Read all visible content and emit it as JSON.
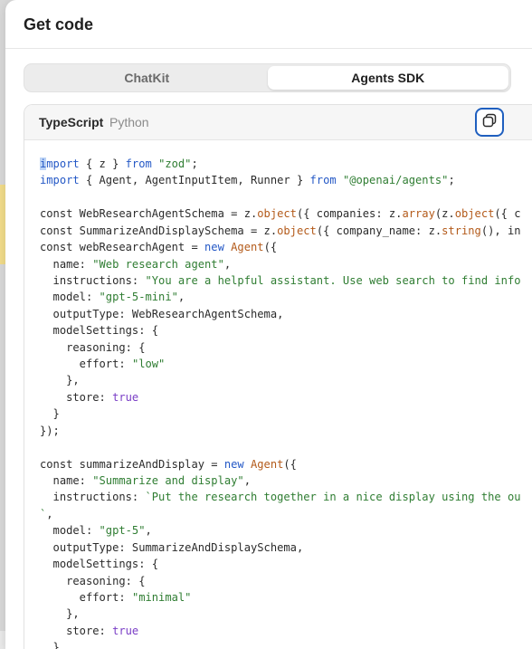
{
  "dialog": {
    "title": "Get code"
  },
  "tabs": [
    {
      "label": "ChatKit",
      "active": false
    },
    {
      "label": "Agents SDK",
      "active": true
    }
  ],
  "code_panel": {
    "languages": [
      {
        "label": "TypeScript",
        "active": true
      },
      {
        "label": "Python",
        "active": false
      }
    ],
    "copy_icon": "copy-icon",
    "lines": [
      [
        "import",
        " { z } ",
        "from",
        " ",
        "\"zod\"",
        ";"
      ],
      [
        "import",
        " { Agent, AgentInputItem, Runner } ",
        "from",
        " ",
        "\"@openai/agents\"",
        ";"
      ],
      [
        ""
      ],
      [
        "const WebResearchAgentSchema = z.",
        "object",
        "({ companies: z.",
        "array",
        "(z.",
        "object",
        "({ c"
      ],
      [
        "const SummarizeAndDisplaySchema = z.",
        "object",
        "({ company_name: z.",
        "string",
        "(), in"
      ],
      [
        "const webResearchAgent = ",
        "new",
        " ",
        "Agent",
        "({"
      ],
      [
        "  name: ",
        "\"Web research agent\"",
        ","
      ],
      [
        "  instructions: ",
        "\"You are a helpful assistant. Use web search to find info"
      ],
      [
        "  model: ",
        "\"gpt-5-mini\"",
        ","
      ],
      [
        "  outputType: WebResearchAgentSchema,"
      ],
      [
        "  modelSettings: {"
      ],
      [
        "    reasoning: {"
      ],
      [
        "      effort: ",
        "\"low\""
      ],
      [
        "    },"
      ],
      [
        "    store: ",
        "true"
      ],
      [
        "  }"
      ],
      [
        "});"
      ],
      [
        ""
      ],
      [
        "const summarizeAndDisplay = ",
        "new",
        " ",
        "Agent",
        "({"
      ],
      [
        "  name: ",
        "\"Summarize and display\"",
        ","
      ],
      [
        "  instructions: ",
        "`Put the research together in a nice display using the ou"
      ],
      [
        "`",
        ","
      ],
      [
        "  model: ",
        "\"gpt-5\"",
        ","
      ],
      [
        "  outputType: SummarizeAndDisplaySchema,"
      ],
      [
        "  modelSettings: {"
      ],
      [
        "    reasoning: {"
      ],
      [
        "      effort: ",
        "\"minimal\""
      ],
      [
        "    },"
      ],
      [
        "    store: ",
        "true"
      ],
      [
        "  }"
      ]
    ],
    "token_classes": [
      [
        "k",
        "",
        "k",
        "",
        "s",
        ""
      ],
      [
        "k",
        "",
        "k",
        "",
        "s",
        ""
      ],
      [
        ""
      ],
      [
        "",
        "f",
        "",
        "f",
        "",
        "f",
        ""
      ],
      [
        "",
        "f",
        "",
        "f",
        ""
      ],
      [
        "",
        "k",
        "",
        "f",
        ""
      ],
      [
        "",
        "s",
        ""
      ],
      [
        "",
        "s"
      ],
      [
        "",
        "s",
        ""
      ],
      [
        ""
      ],
      [
        ""
      ],
      [
        ""
      ],
      [
        "",
        "s"
      ],
      [
        ""
      ],
      [
        "",
        "b"
      ],
      [
        ""
      ],
      [
        ""
      ],
      [
        ""
      ],
      [
        "",
        "k",
        "",
        "f",
        ""
      ],
      [
        "",
        "s",
        ""
      ],
      [
        "",
        "s"
      ],
      [
        "s",
        ""
      ],
      [
        "",
        "s",
        ""
      ],
      [
        ""
      ],
      [
        ""
      ],
      [
        ""
      ],
      [
        "",
        "s"
      ],
      [
        ""
      ],
      [
        "",
        "b"
      ],
      [
        ""
      ]
    ]
  }
}
